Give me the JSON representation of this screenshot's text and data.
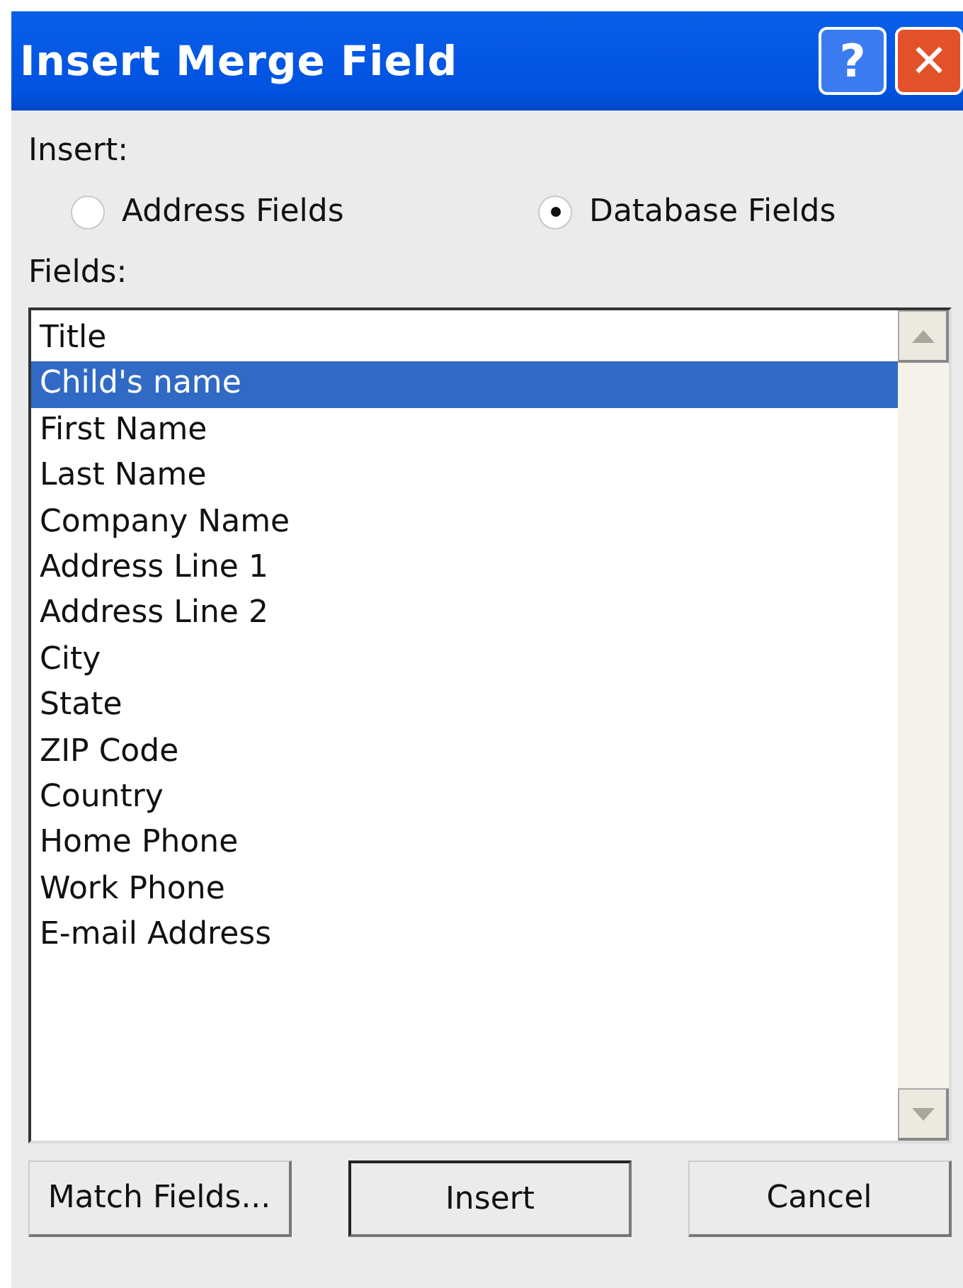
{
  "window": {
    "title": "Insert Merge Field",
    "help_button": "?",
    "close_button": "✕"
  },
  "insert_label": "Insert:",
  "options": [
    {
      "label": "Address Fields",
      "selected": false
    },
    {
      "label": "Database Fields",
      "selected": true
    }
  ],
  "fields_label": "Fields:",
  "fields": [
    {
      "label": "Title",
      "selected": false
    },
    {
      "label": "Child's name",
      "selected": true
    },
    {
      "label": "First Name",
      "selected": false
    },
    {
      "label": "Last Name",
      "selected": false
    },
    {
      "label": "Company Name",
      "selected": false
    },
    {
      "label": "Address Line 1",
      "selected": false
    },
    {
      "label": "Address Line 2",
      "selected": false
    },
    {
      "label": "City",
      "selected": false
    },
    {
      "label": "State",
      "selected": false
    },
    {
      "label": "ZIP Code",
      "selected": false
    },
    {
      "label": "Country",
      "selected": false
    },
    {
      "label": "Home Phone",
      "selected": false
    },
    {
      "label": "Work Phone",
      "selected": false
    },
    {
      "label": "E-mail Address",
      "selected": false
    }
  ],
  "buttons": [
    {
      "label": "Match Fields...",
      "default": false
    },
    {
      "label": "Insert",
      "default": true
    },
    {
      "label": "Cancel",
      "default": false
    }
  ]
}
